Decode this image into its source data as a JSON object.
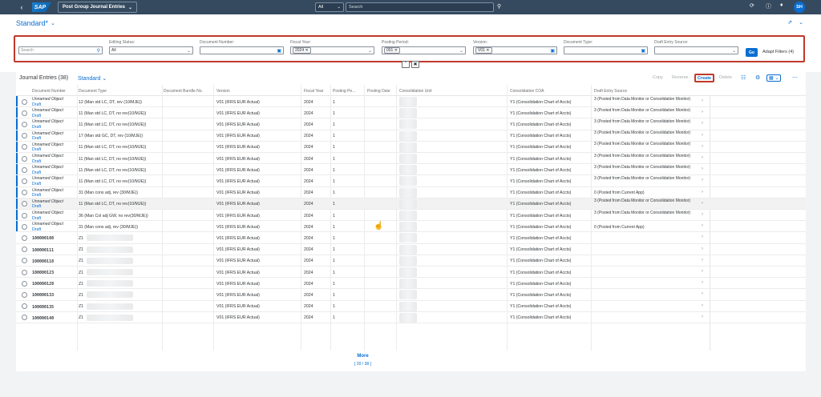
{
  "shell": {
    "back_icon": "back-arrow-icon",
    "logo": "SAP",
    "app_title": "Post Group Journal Entries",
    "scope": "All",
    "search_placeholder": "Search",
    "icons": [
      "recent-activity-icon",
      "help-icon",
      "notification-icon"
    ],
    "avatar_initials": "SH"
  },
  "header": {
    "variant": "Standard*",
    "filters": [
      {
        "label": "",
        "value": "",
        "placeholder": "Search"
      },
      {
        "label": "Editing Status:",
        "value": "All"
      },
      {
        "label": "Document Number:",
        "value": ""
      },
      {
        "label": "Fiscal Year:",
        "value": "2024"
      },
      {
        "label": "Posting Period:",
        "value": "001"
      },
      {
        "label": "Version:",
        "value": "V01"
      },
      {
        "label": "Document Type:",
        "value": ""
      },
      {
        "label": "Draft Entry Source:",
        "value": ""
      }
    ],
    "go_label": "Go",
    "adapt_label": "Adapt Filters (4)"
  },
  "table": {
    "title": "Journal Entries (38)",
    "variant": "Standard",
    "toolbar": {
      "copy": "Copy",
      "reverse": "Reverse",
      "create": "Create",
      "delete": "Delete"
    },
    "columns": [
      "Document Number",
      "Document Type",
      "Document Bundle No.",
      "Version",
      "Fiscal Year",
      "Posting Pe...",
      "Posting Date",
      "Consolidation Unit",
      "Consolidation COA",
      "Draft Entry Source"
    ],
    "rows": [
      {
        "doc": "Unnamed Object",
        "status": "Draft",
        "type": "12 (Man std LC, DT, rev (10/MJE))",
        "version": "V01 (IFRS EUR Actual)",
        "year": "2024",
        "period": "1",
        "coa": "Y1 (Consolidation Chart of Accts)",
        "source": "3 (Posted from Data Monitor or Consolidation Monitor)"
      },
      {
        "doc": "Unnamed Object",
        "status": "Draft",
        "type": "11 (Man std LC, DT, no rev(10/MJE))",
        "version": "V01 (IFRS EUR Actual)",
        "year": "2024",
        "period": "1",
        "coa": "Y1 (Consolidation Chart of Accts)",
        "source": "3 (Posted from Data Monitor or Consolidation Monitor)"
      },
      {
        "doc": "Unnamed Object",
        "status": "Draft",
        "type": "11 (Man std LC, DT, no rev(10/MJE))",
        "version": "V01 (IFRS EUR Actual)",
        "year": "2024",
        "period": "1",
        "coa": "Y1 (Consolidation Chart of Accts)",
        "source": "3 (Posted from Data Monitor or Consolidation Monitor)"
      },
      {
        "doc": "Unnamed Object",
        "status": "Draft",
        "type": "17 (Man std GC, DT, rev (10/MJE))",
        "version": "V01 (IFRS EUR Actual)",
        "year": "2024",
        "period": "1",
        "coa": "Y1 (Consolidation Chart of Accts)",
        "source": "3 (Posted from Data Monitor or Consolidation Monitor)"
      },
      {
        "doc": "Unnamed Object",
        "status": "Draft",
        "type": "11 (Man std LC, DT, no rev(10/MJE))",
        "version": "V01 (IFRS EUR Actual)",
        "year": "2024",
        "period": "1",
        "coa": "Y1 (Consolidation Chart of Accts)",
        "source": "3 (Posted from Data Monitor or Consolidation Monitor)"
      },
      {
        "doc": "Unnamed Object",
        "status": "Draft",
        "type": "11 (Man std LC, DT, no rev(10/MJE))",
        "version": "V01 (IFRS EUR Actual)",
        "year": "2024",
        "period": "1",
        "coa": "Y1 (Consolidation Chart of Accts)",
        "source": "3 (Posted from Data Monitor or Consolidation Monitor)"
      },
      {
        "doc": "Unnamed Object",
        "status": "Draft",
        "type": "11 (Man std LC, DT, no rev(10/MJE))",
        "version": "V01 (IFRS EUR Actual)",
        "year": "2024",
        "period": "1",
        "coa": "Y1 (Consolidation Chart of Accts)",
        "source": "3 (Posted from Data Monitor or Consolidation Monitor)"
      },
      {
        "doc": "Unnamed Object",
        "status": "Draft",
        "type": "11 (Man std LC, DT, no rev(10/MJE))",
        "version": "V01 (IFRS EUR Actual)",
        "year": "2024",
        "period": "1",
        "coa": "Y1 (Consolidation Chart of Accts)",
        "source": "3 (Posted from Data Monitor or Consolidation Monitor)"
      },
      {
        "doc": "Unnamed Object",
        "status": "Draft",
        "type": "31 (Man cons adj, rev (30/MJE))",
        "version": "V01 (IFRS EUR Actual)",
        "year": "2024",
        "period": "1",
        "coa": "Y1 (Consolidation Chart of Accts)",
        "source": "0 (Posted from Current App)"
      },
      {
        "doc": "Unnamed Object",
        "status": "Draft",
        "type": "11 (Man std LC, DT, no rev(10/MJE))",
        "version": "V01 (IFRS EUR Actual)",
        "year": "2024",
        "period": "1",
        "coa": "Y1 (Consolidation Chart of Accts)",
        "source": "3 (Posted from Data Monitor or Consolidation Monitor)"
      },
      {
        "doc": "Unnamed Object",
        "status": "Draft",
        "type": "36 (Man Col adj GW, no rev(30/MJE))",
        "version": "V01 (IFRS EUR Actual)",
        "year": "2024",
        "period": "1",
        "coa": "Y1 (Consolidation Chart of Accts)",
        "source": "3 (Posted from Data Monitor or Consolidation Monitor)"
      },
      {
        "doc": "Unnamed Object",
        "status": "Draft",
        "type": "31 (Man cons adj, rev (30/MJE))",
        "version": "V01 (IFRS EUR Actual)",
        "year": "2024",
        "period": "1",
        "coa": "Y1 (Consolidation Chart of Accts)",
        "source": "0 (Posted from Current App)"
      },
      {
        "doc": "100000108",
        "type": "Z1",
        "version": "V01 (IFRS EUR Actual)",
        "year": "2024",
        "period": "1",
        "coa": "Y1 (Consolidation Chart of Accts)",
        "source": ""
      },
      {
        "doc": "100000111",
        "type": "Z1",
        "version": "V01 (IFRS EUR Actual)",
        "year": "2024",
        "period": "1",
        "coa": "Y1 (Consolidation Chart of Accts)",
        "source": ""
      },
      {
        "doc": "100000118",
        "type": "Z1",
        "version": "V01 (IFRS EUR Actual)",
        "year": "2024",
        "period": "1",
        "coa": "Y1 (Consolidation Chart of Accts)",
        "source": ""
      },
      {
        "doc": "100000123",
        "type": "Z1",
        "version": "V01 (IFRS EUR Actual)",
        "year": "2024",
        "period": "1",
        "coa": "Y1 (Consolidation Chart of Accts)",
        "source": ""
      },
      {
        "doc": "100000128",
        "type": "Z1",
        "version": "V01 (IFRS EUR Actual)",
        "year": "2024",
        "period": "1",
        "coa": "Y1 (Consolidation Chart of Accts)",
        "source": ""
      },
      {
        "doc": "100000133",
        "type": "Z1",
        "version": "V01 (IFRS EUR Actual)",
        "year": "2024",
        "period": "1",
        "coa": "Y1 (Consolidation Chart of Accts)",
        "source": ""
      },
      {
        "doc": "100000135",
        "type": "Z1",
        "version": "V01 (IFRS EUR Actual)",
        "year": "2024",
        "period": "1",
        "coa": "Y1 (Consolidation Chart of Accts)",
        "source": ""
      },
      {
        "doc": "100000140",
        "type": "Z1",
        "version": "V01 (IFRS EUR Actual)",
        "year": "2024",
        "period": "1",
        "coa": "Y1 (Consolidation Chart of Accts)",
        "source": ""
      }
    ],
    "more_label": "More",
    "more_count": "[ 20 / 38 ]"
  },
  "colors": {
    "shell": "#354a5f",
    "accent": "#0a6ed1",
    "highlight": "#c0392b"
  }
}
